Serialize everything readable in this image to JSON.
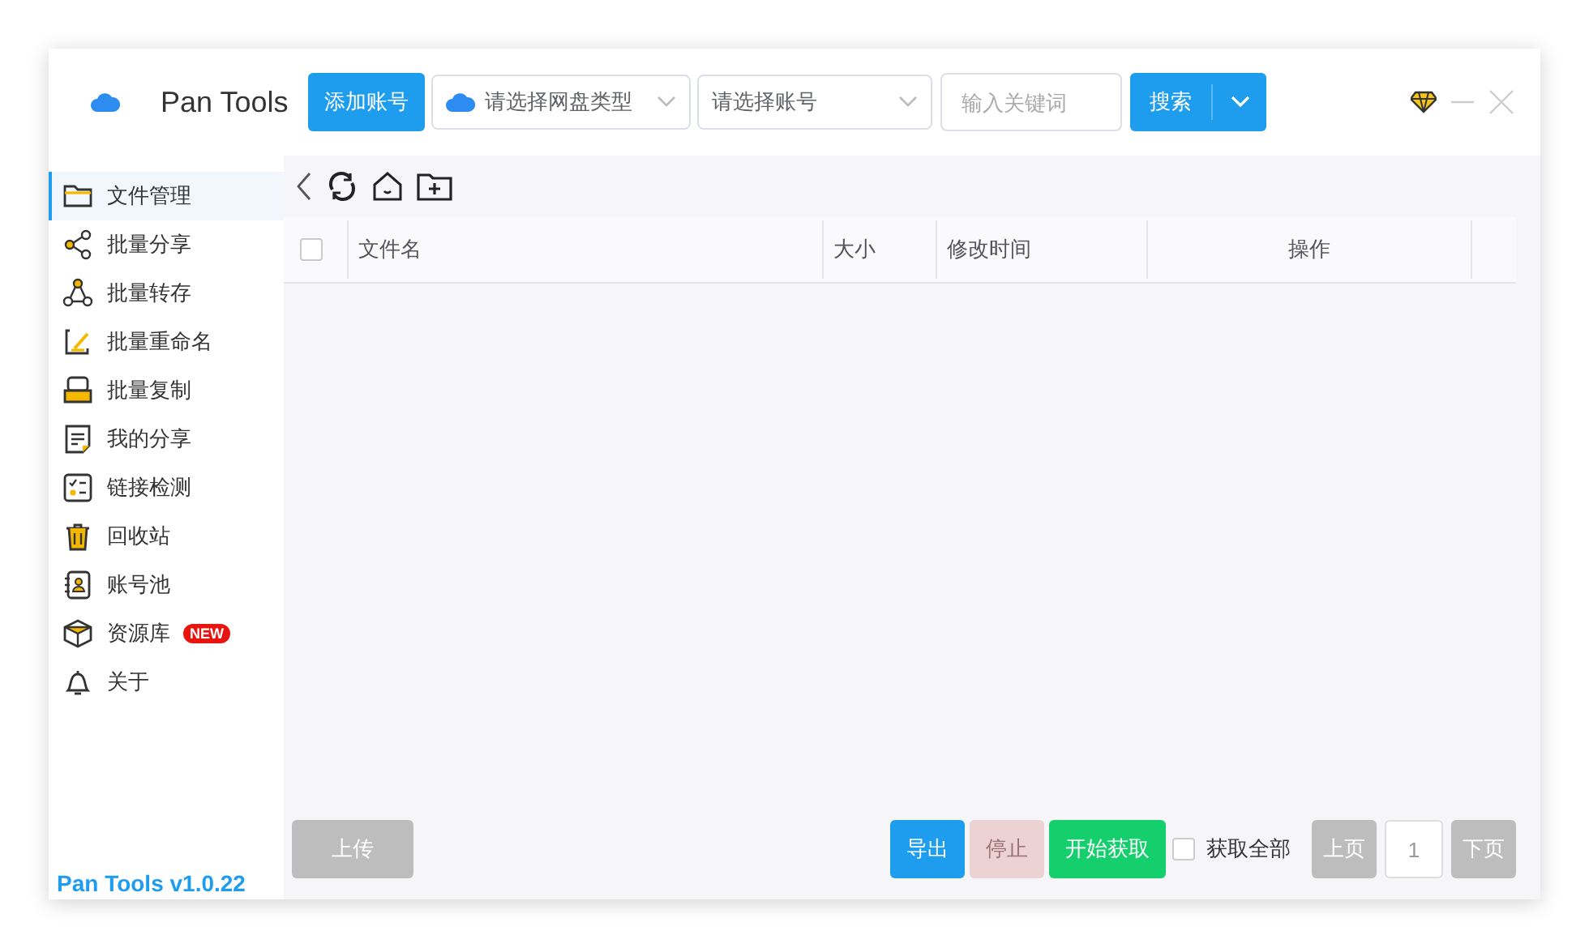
{
  "app": {
    "title": "Pan Tools"
  },
  "header": {
    "add_account": "添加账号",
    "drive_type": {
      "placeholder": "请选择网盘类型"
    },
    "account": {
      "placeholder": "请选择账号"
    },
    "keyword": {
      "placeholder": "输入关键词"
    },
    "search": "搜索"
  },
  "sidebar": {
    "items": [
      {
        "label": "文件管理",
        "selected": true
      },
      {
        "label": "批量分享",
        "selected": false
      },
      {
        "label": "批量转存",
        "selected": false
      },
      {
        "label": "批量重命名",
        "selected": false
      },
      {
        "label": "批量复制",
        "selected": false
      },
      {
        "label": "我的分享",
        "selected": false
      },
      {
        "label": "链接检测",
        "selected": false
      },
      {
        "label": "回收站",
        "selected": false
      },
      {
        "label": "账号池",
        "selected": false
      },
      {
        "label": "资源库",
        "selected": false,
        "badge": "NEW"
      },
      {
        "label": "关于",
        "selected": false
      }
    ],
    "version": "Pan Tools v1.0.22"
  },
  "table": {
    "select_all_checked": false,
    "columns": [
      "文件名",
      "大小",
      "修改时间",
      "操作"
    ]
  },
  "footer": {
    "upload": {
      "label": "上传",
      "disabled": true
    },
    "actions": [
      {
        "label": "导出",
        "kind": "primary",
        "disabled": false
      },
      {
        "label": "停止",
        "kind": "danger",
        "disabled": true
      },
      {
        "label": "开始获取",
        "kind": "success",
        "disabled": false
      }
    ],
    "fetch_all": {
      "label": "获取全部",
      "checked": false
    },
    "prev": {
      "label": "上页",
      "disabled": true
    },
    "page": "1",
    "next": {
      "label": "下页",
      "disabled": true
    }
  }
}
